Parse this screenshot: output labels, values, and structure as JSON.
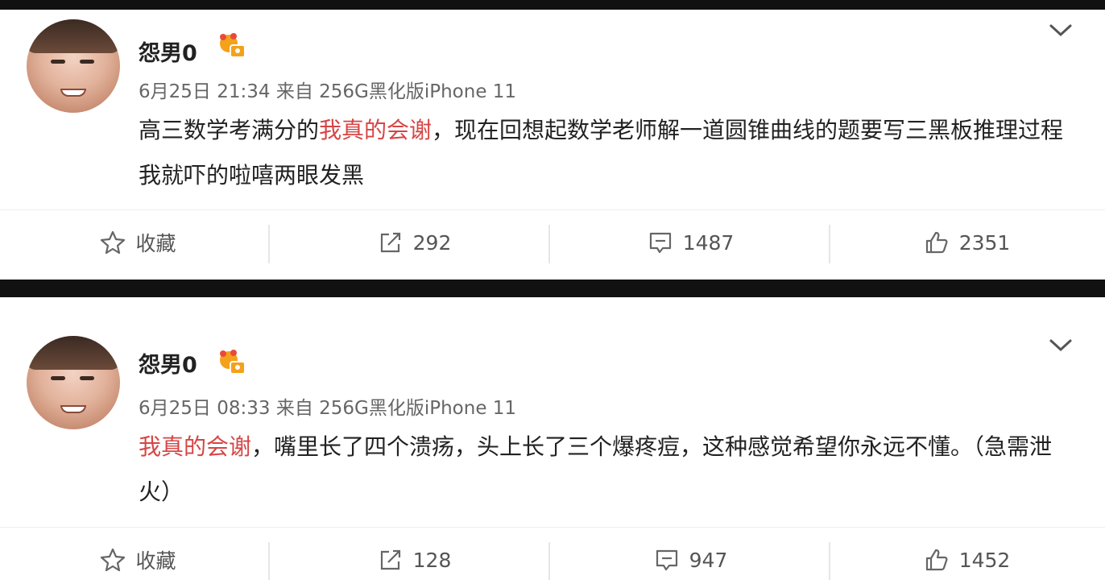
{
  "posts": [
    {
      "username": "怨男0",
      "timestamp": "6月25日 21:34",
      "source": "来自 256G黑化版iPhone 11",
      "highlight": "我真的会谢",
      "text_before": "高三数学考满分的",
      "text_after": "，现在回想起数学老师解一道圆锥曲线的题要写三黑板推理过程我就吓的啦嘻两眼发黑",
      "actions": {
        "favorite_label": "收藏",
        "repost_count": "292",
        "comment_count": "1487",
        "like_count": "2351"
      }
    },
    {
      "username": "怨男0",
      "timestamp": "6月25日 08:33",
      "source": "来自 256G黑化版iPhone 11",
      "highlight": "我真的会谢",
      "text_before": "",
      "text_after": "，嘴里长了四个溃疡，头上长了三个爆疼痘，这种感觉希望你永远不懂。（急需泄火）",
      "actions": {
        "favorite_label": "收藏",
        "repost_count": "128",
        "comment_count": "947",
        "like_count": "1452"
      }
    }
  ],
  "colors": {
    "highlight": "#d64545",
    "divider": "#111111"
  },
  "icons": [
    "vip-crown-icon",
    "chevron-down-icon",
    "star-icon",
    "repost-icon",
    "comment-icon",
    "thumbs-up-icon"
  ]
}
